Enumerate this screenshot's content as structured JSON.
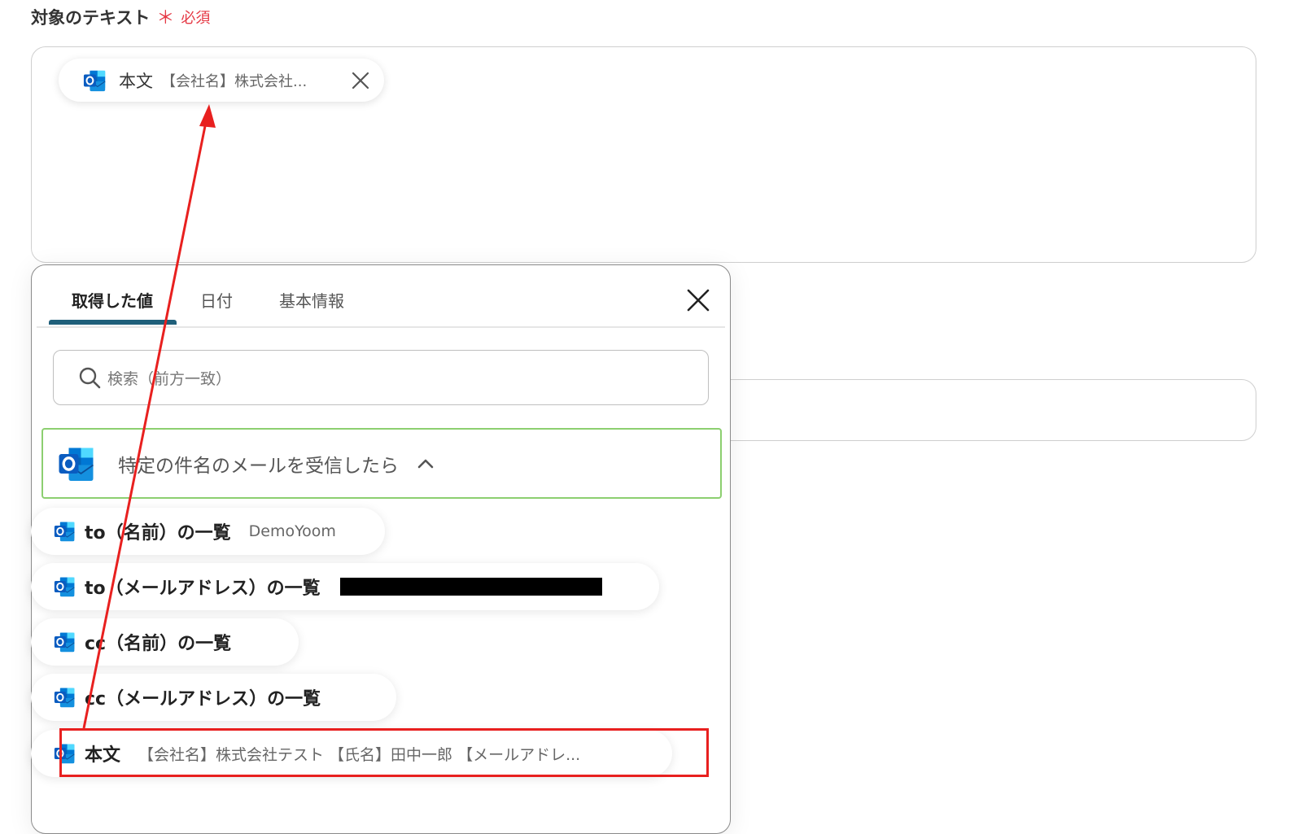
{
  "field": {
    "label": "対象のテキスト",
    "required_mark": "＊",
    "required_text": "必須"
  },
  "selected_chip": {
    "icon": "outlook-icon",
    "title": "本文",
    "preview": "【会社名】株式会社..."
  },
  "panel": {
    "tabs": [
      "取得した値",
      "日付",
      "基本情報"
    ],
    "active_tab": "取得した値",
    "search_placeholder": "検索（前方一致）",
    "group": {
      "icon": "outlook-icon",
      "title": "特定の件名のメールを受信したら",
      "expanded": true
    },
    "items": [
      {
        "label": "to（名前）の一覧",
        "value": "DemoYoom"
      },
      {
        "label": "to（メールアドレス）の一覧",
        "value": ""
      },
      {
        "label": "cc（名前）の一覧",
        "value": ""
      },
      {
        "label": "cc（メールアドレス）の一覧",
        "value": ""
      },
      {
        "label": "本文",
        "value": "【会社名】株式会社テスト 【氏名】田中一郎 【メールアドレ..."
      }
    ]
  },
  "colors": {
    "accent_tab": "#1f5f7a",
    "required": "#e53945",
    "group_border": "#8ccf70",
    "annotation": "#e8201f",
    "outlook_blue": "#0a64c9"
  }
}
